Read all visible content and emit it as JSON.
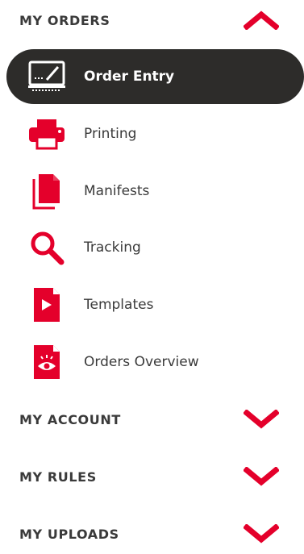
{
  "sections": {
    "my_orders": {
      "title": "MY ORDERS",
      "expanded": true
    },
    "my_account": {
      "title": "MY ACCOUNT",
      "expanded": false
    },
    "my_rules": {
      "title": "MY RULES",
      "expanded": false
    },
    "my_uploads": {
      "title": "MY UPLOADS",
      "expanded": false
    }
  },
  "items": [
    {
      "label": "Order Entry",
      "icon": "computer-icon",
      "active": true
    },
    {
      "label": "Printing",
      "icon": "printer-icon",
      "active": false
    },
    {
      "label": "Manifests",
      "icon": "document-stack-icon",
      "active": false
    },
    {
      "label": "Tracking",
      "icon": "magnifier-icon",
      "active": false
    },
    {
      "label": "Templates",
      "icon": "play-document-icon",
      "active": false
    },
    {
      "label": "Orders Overview",
      "icon": "eye-document-icon",
      "active": false
    }
  ],
  "colors": {
    "accent": "#e4002b",
    "active_bg": "#2d2c2a",
    "text": "#3a3a3a"
  }
}
